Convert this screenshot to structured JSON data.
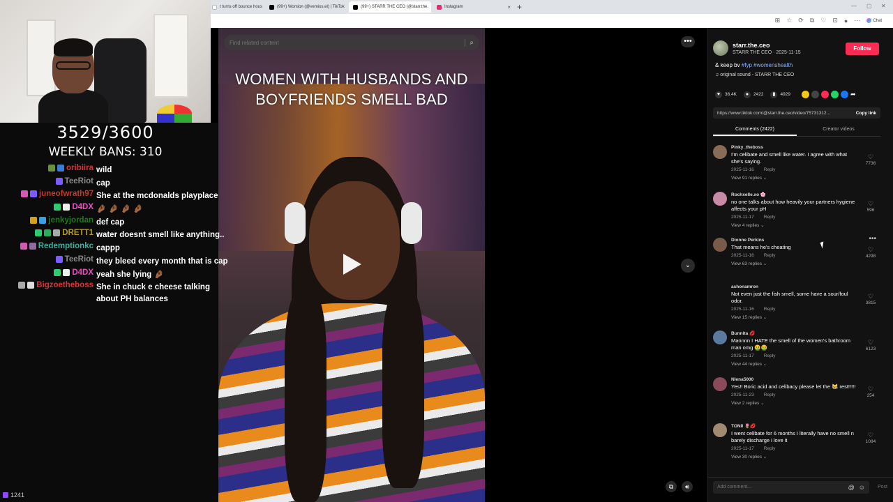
{
  "browser": {
    "tabs": [
      {
        "title": "t turns off bounce hous",
        "favicon_color": "#ffffff",
        "active": false
      },
      {
        "title": "(99+) Womion (@vemios.el) | TikTok",
        "favicon_color": "#000000",
        "active": false
      },
      {
        "title": "(99+) STARR THE CEO (@starr.the.",
        "favicon_color": "#000000",
        "active": true
      },
      {
        "title": "Instagram",
        "favicon_color": "#e1306c",
        "active": false
      }
    ],
    "new_tab": "+",
    "chat_label": "Chat"
  },
  "stream": {
    "counter": "3529/3600",
    "weekly_bans": "WEEKLY BANS: 310",
    "viewer_count": "1241",
    "chat": [
      {
        "user": "oribiira",
        "color": "#d63434",
        "message": "wild",
        "badges": [
          "#6b8f3a",
          "#3a7bd5"
        ]
      },
      {
        "user": "TeeRiot",
        "color": "#8a8a8a",
        "message": "cap",
        "badges": [
          "#7b5cff"
        ]
      },
      {
        "user": "juneofwrath97",
        "color": "#c0392b",
        "message": "She at the mcdonalds playplace",
        "badges": [
          "#d35ab0",
          "#7b5cff"
        ]
      },
      {
        "user": "D4DX",
        "color": "#e84fbf",
        "message": "🤌🏾 🤌🏾 🤌🏾 🤌🏾",
        "badges": [
          "#2ecc71",
          "#eeeeee"
        ]
      },
      {
        "user": "jenkyjordan",
        "color": "#1f7a1f",
        "message": "def cap",
        "badges": [
          "#d4a017",
          "#3aa0e0"
        ]
      },
      {
        "user": "DRETT1",
        "color": "#b59a1f",
        "message": "water doesnt smell like anything..",
        "badges": [
          "#2ecc71",
          "#27ae60",
          "#aaaaaa"
        ]
      },
      {
        "user": "Redemptionkc",
        "color": "#3fae9b",
        "message": "cappp",
        "badges": [
          "#d35ab0",
          "#8e6aa0"
        ]
      },
      {
        "user": "TeeRiot",
        "color": "#8a8a8a",
        "message": "they bleed every month that is cap",
        "badges": [
          "#7b5cff"
        ]
      },
      {
        "user": "D4DX",
        "color": "#e84fbf",
        "message": "yeah she lying 🤌🏾",
        "badges": [
          "#2ecc71",
          "#eeeeee"
        ]
      },
      {
        "user": "Bigzoetheboss",
        "color": "#d63434",
        "message": "She in chuck e cheese talking about PH balances",
        "badges": [
          "#aaaaaa",
          "#dddddd"
        ]
      }
    ]
  },
  "video": {
    "search_placeholder": "Find related content",
    "caption": "WOMEN WITH HUSBANDS AND BOYFRIENDS SMELL BAD"
  },
  "post": {
    "author": "starr.the.ceo",
    "author_sub": "STARR THE CEO · 2025-11-15",
    "follow_label": "Follow",
    "desc_prefix": "& keep bv ",
    "desc_tags": "#fyp #womenshealth",
    "sound": "♫ original sound - STARR THE CEO",
    "likes": "36.4K",
    "comments_count": "2422",
    "saves": "4929",
    "link": "https://www.tiktok.com/@starr.the.ceo/video/75731312...",
    "copy_link": "Copy link",
    "tab_comments": "Comments (2422)",
    "tab_creator": "Creator videos",
    "add_comment_placeholder": "Add comment...",
    "post_label": "Post"
  },
  "comments": [
    {
      "name": "Pinky_theboss",
      "text": "I'm celibate and smell like water. I agree with what she's saying.",
      "date": "2025-11-16",
      "reply": "Reply",
      "replies": "View 91 replies ⌄",
      "likes": "7736",
      "avatar": "#8a6b55"
    },
    {
      "name": "Rochxelle.xo 🌸",
      "text": "no one talks about how heavily your partners hygiene affects your pH",
      "date": "2025-11-17",
      "reply": "Reply",
      "replies": "View 4 replies ⌄",
      "likes": "596",
      "avatar": "#c98aa8"
    },
    {
      "name": "Dionne Perkins",
      "text": "That means he's cheating",
      "date": "2025-11-16",
      "reply": "Reply",
      "replies": "View 63 replies ⌄",
      "likes": "4298",
      "avatar": "#7a5a4a"
    },
    {
      "name": "ashonamron",
      "text": "Not even just the fish smell, some have a sour/foul odor.",
      "date": "2025-11-16",
      "reply": "Reply",
      "replies": "View 15 replies ⌄",
      "likes": "3815",
      "avatar": "#121212"
    },
    {
      "name": "Bunnita 💋",
      "text": "Mannnn I HATE the smell of the women's bathroom man omg 🤮🤮",
      "date": "2025-11-17",
      "reply": "Reply",
      "replies": "View 44 replies ⌄",
      "likes": "6123",
      "avatar": "#5a7aa0"
    },
    {
      "name": "Nlena5000",
      "text": "Yes!! Boric acid and celibacy please let the 😹 rest!!!!!",
      "date": "2025-11-23",
      "reply": "Reply",
      "replies": "View 2 replies ⌄",
      "likes": "254",
      "avatar": "#8a4a5a"
    },
    {
      "name": "TONII 🌷💋",
      "text": "I went celibate for 6 months I literally have no smell n barely discharge i love it",
      "date": "2025-11-17",
      "reply": "Reply",
      "replies": "View 30 replies ⌄",
      "likes": "1084",
      "avatar": "#a08a70"
    },
    {
      "name": "Dr_Drey",
      "text": "",
      "date": "",
      "reply": "",
      "replies": "",
      "likes": "",
      "avatar": "#6a5a4a"
    }
  ]
}
